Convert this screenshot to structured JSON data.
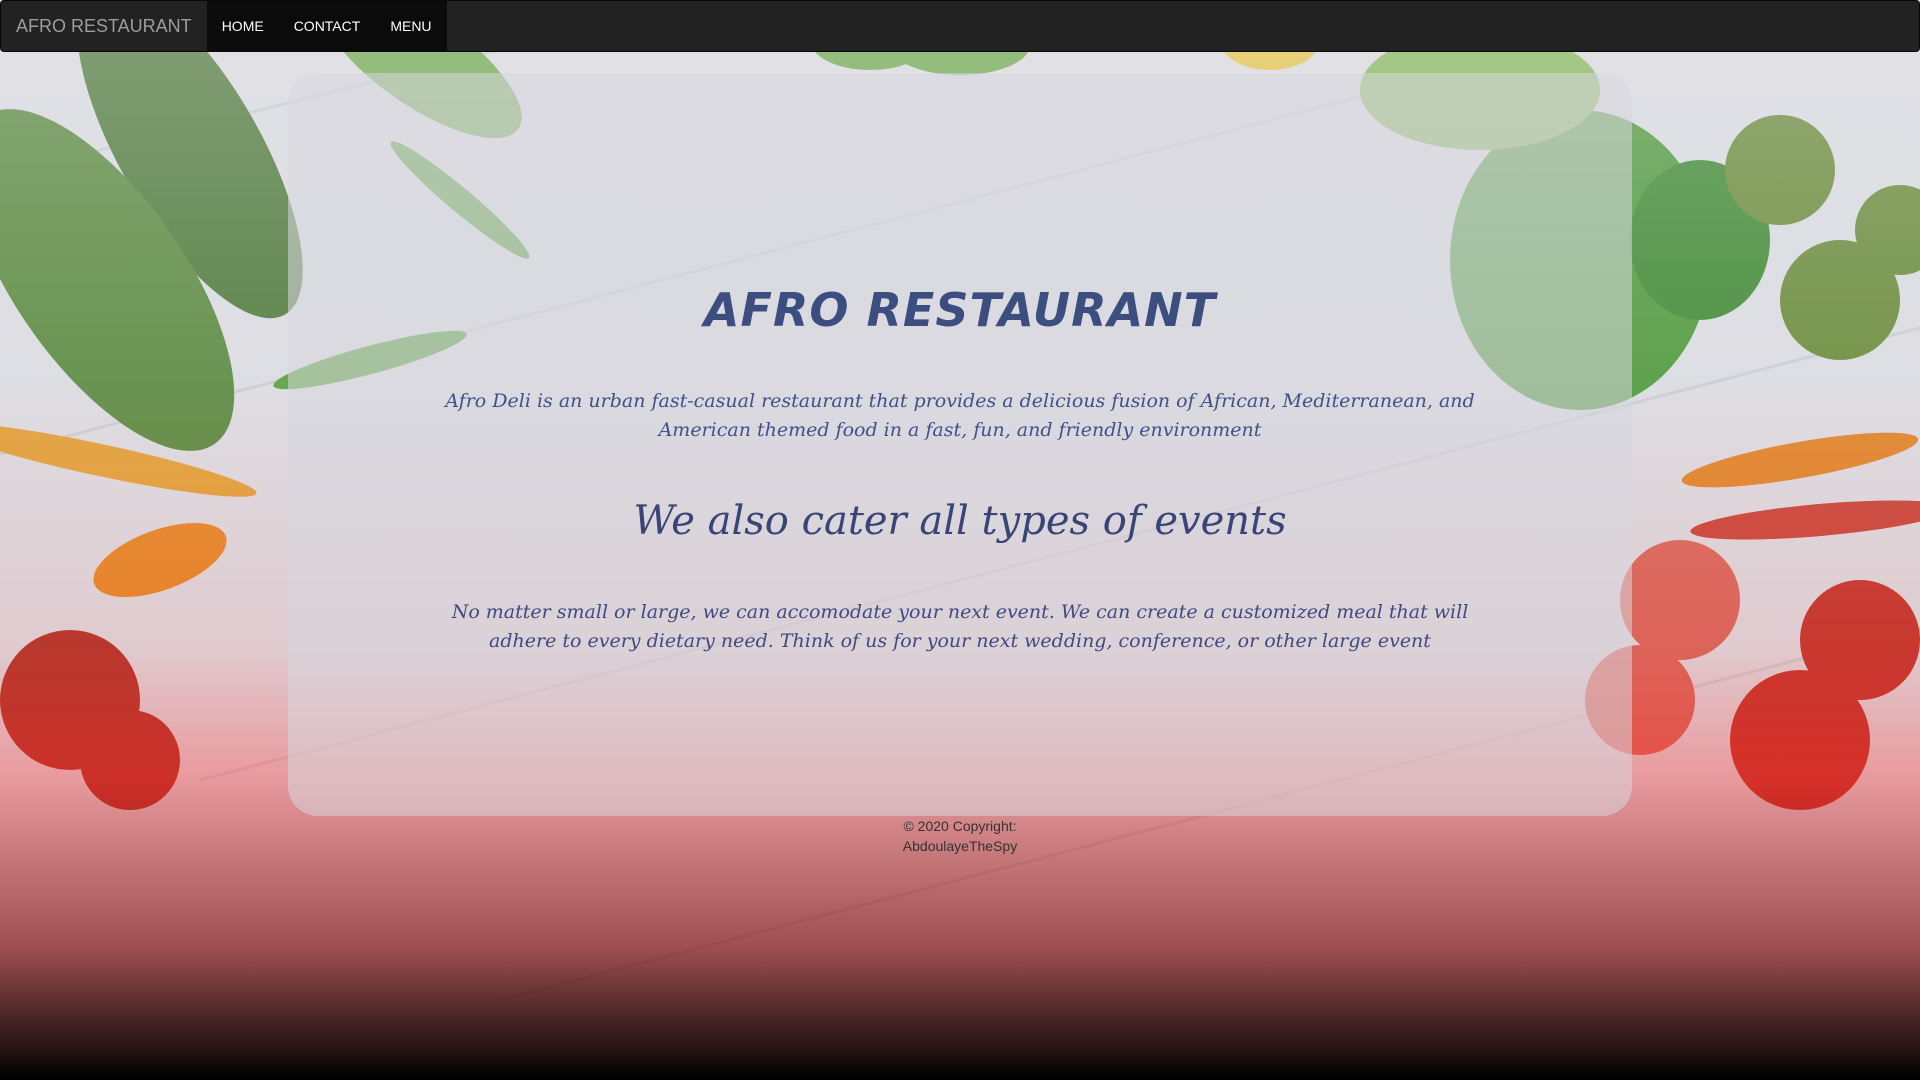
{
  "navbar": {
    "brand": "AFRO RESTAURANT",
    "links": [
      {
        "label": "HOME"
      },
      {
        "label": "CONTACT"
      },
      {
        "label": "MENU"
      }
    ]
  },
  "hero": {
    "title": "AFRO RESTAURANT",
    "intro": "Afro Deli is an urban fast-casual restaurant that provides a delicious fusion of African, Mediterranean, and American themed food in a fast, fun, and friendly environment",
    "subtitle": "We also cater all types of events",
    "events_text": "No matter small or large, we can accomodate your next event. We can create a customized meal that will adhere to every dietary need. Think of us for your next wedding, conference, or other large event"
  },
  "footer": {
    "line1": "© 2020 Copyright:",
    "line2": "AbdoulayeTheSpy"
  },
  "colors": {
    "navbar_bg": "#222222",
    "nav_active_bg": "#0b0b0b",
    "heading_text": "#3c4d80",
    "gradient_red": "#ff1f1f",
    "gradient_bottom": "#000000"
  }
}
